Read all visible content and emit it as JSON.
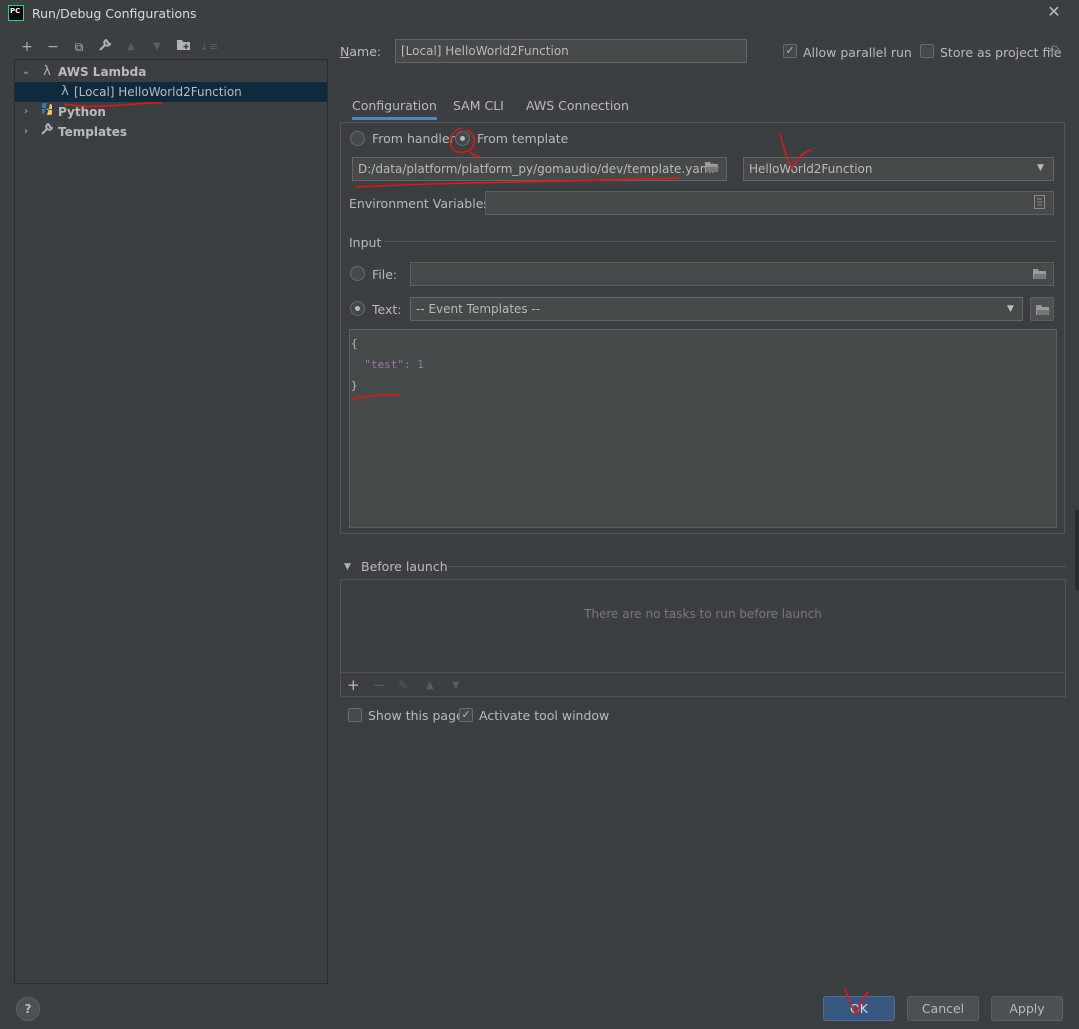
{
  "window": {
    "title": "Run/Debug Configurations",
    "logo_text": "PC"
  },
  "toolbar": {
    "icons": [
      "add-icon",
      "remove-icon",
      "copy-icon",
      "wrench-icon",
      "move-up-icon",
      "move-down-icon",
      "folder-icon",
      "sort-icon"
    ]
  },
  "tree": {
    "items": [
      {
        "label": "AWS Lambda",
        "icon": "lambda-icon",
        "expanded": true
      },
      {
        "label": "[Local] HelloWorld2Function",
        "icon": "lambda-icon",
        "selected": true
      },
      {
        "label": "Python",
        "icon": "python-icon",
        "expanded": false
      },
      {
        "label": "Templates",
        "icon": "wrench-icon",
        "expanded": false
      }
    ]
  },
  "form": {
    "name_label": "Name:",
    "name_value": "[Local] HelloWorld2Function",
    "allow_parallel_label": "Allow parallel run",
    "allow_parallel_checked": true,
    "store_project_label": "Store as project file",
    "store_project_checked": false
  },
  "tabs": [
    {
      "label": "Configuration",
      "active": true
    },
    {
      "label": "SAM CLI",
      "active": false
    },
    {
      "label": "AWS Connection",
      "active": false
    }
  ],
  "config": {
    "from_handler_label": "From handler",
    "from_template_label": "From template",
    "selected_source": "From template",
    "template_path": "D:/data/platform/platform_py/gomaudio/dev/template.yaml",
    "function_selected": "HelloWorld2Function",
    "env_vars_label": "Environment Variables:",
    "env_vars_value": "",
    "input_section_label": "Input",
    "file_label": "File:",
    "file_value": "",
    "text_label": "Text:",
    "input_mode": "Text",
    "event_templates_selected": "-- Event Templates --",
    "editor_lines": [
      "{",
      "  \"test\": 1",
      "}"
    ]
  },
  "before_launch": {
    "label": "Before launch",
    "empty_text": "There are no tasks to run before launch"
  },
  "options": {
    "show_page_label": "Show this page",
    "show_page_checked": false,
    "activate_tool_label": "Activate tool window",
    "activate_tool_checked": true
  },
  "buttons": {
    "ok": "OK",
    "cancel": "Cancel",
    "apply": "Apply",
    "help": "?"
  },
  "colors": {
    "background": "#3c3f41",
    "selection": "#0d293e",
    "accent": "#4a88c7",
    "primary_button": "#365880",
    "annotation": "#e01818"
  }
}
